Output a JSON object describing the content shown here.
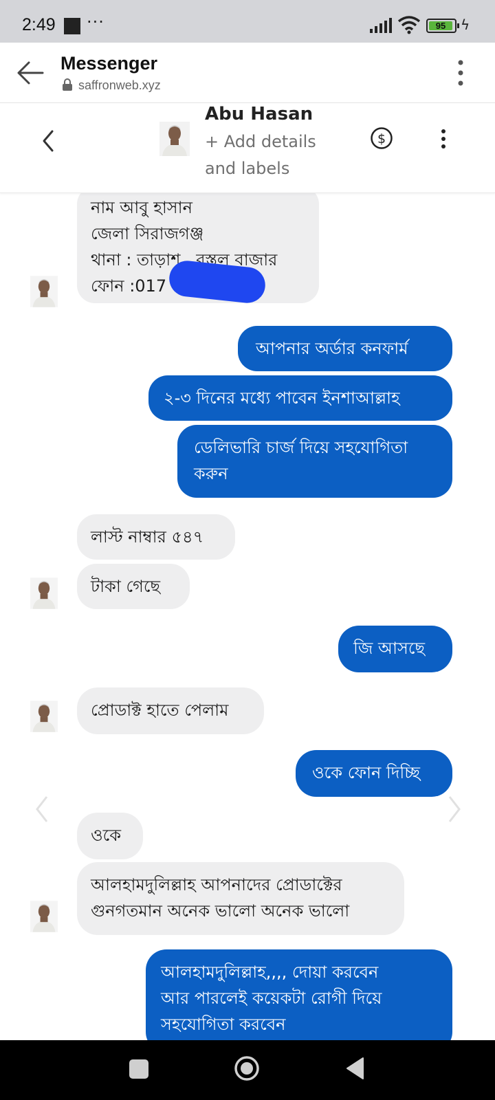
{
  "status_bar": {
    "time": "2:49",
    "more_glyph": "···",
    "battery_level": "95",
    "battery_color": "#5ab53c"
  },
  "browser": {
    "title": "Messenger",
    "url": "saffronweb.xyz",
    "icons": [
      "back-arrow-icon",
      "lock-icon",
      "overflow-menu-icon"
    ]
  },
  "conversation": {
    "contact_name": "Abu Hasan",
    "add_details": "+ Add details and labels",
    "icons": [
      "chevron-left-icon",
      "avatar",
      "dollar-icon",
      "more-vert-icon"
    ]
  },
  "messages": [
    {
      "dir": "in",
      "text": "নাম আবু হাসান\nজেলা সিরাজগঞ্জ\nথানা : তাড়াশ...বস্তুল বাজার\nফোন :017",
      "redacted": true
    },
    {
      "dir": "out",
      "text": "আপনার অর্ডার কনফার্ম"
    },
    {
      "dir": "out",
      "text": "২-৩ দিনের মধ্যে পাবেন ইনশাআল্লাহ"
    },
    {
      "dir": "out",
      "text": "ডেলিভারি চার্জ দিয়ে সহযোগিতা\nকরুন"
    },
    {
      "dir": "in",
      "text": "লাস্ট নাম্বার ৫৪৭"
    },
    {
      "dir": "in",
      "text": "টাকা গেছে"
    },
    {
      "dir": "out",
      "text": "জি আসছে"
    },
    {
      "dir": "in",
      "text": "প্রোডাক্ট হাতে পেলাম"
    },
    {
      "dir": "out",
      "text": "ওকে ফোন দিচ্ছি"
    },
    {
      "dir": "in",
      "text": "ওকে"
    },
    {
      "dir": "in",
      "text": "আলহামদুলিল্লাহ আপনাদের প্রোডাক্টের\nগুনগতমান অনেক ভালো অনেক ভালো"
    },
    {
      "dir": "out",
      "text": "আলহামদুলিল্লাহ,,,, দোয়া করবেন\nআর পারলেই কয়েকটা রোগী দিয়ে\nসহযোগিতা করবেন"
    }
  ],
  "colors": {
    "outgoing_bubble": "#0c5fc3",
    "incoming_bubble": "#eeeeef",
    "redaction": "#1f47f0"
  },
  "nav_bar": {
    "icons": [
      "recents-square-icon",
      "home-circle-icon",
      "back-triangle-icon"
    ]
  }
}
